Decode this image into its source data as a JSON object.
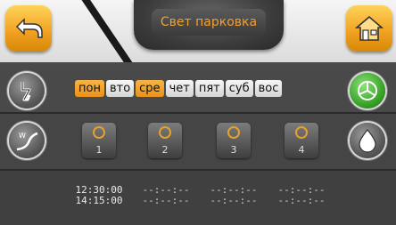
{
  "header": {
    "title": "Свет парковка"
  },
  "days": [
    {
      "label": "пон",
      "active": true
    },
    {
      "label": "вто",
      "active": false
    },
    {
      "label": "сре",
      "active": true
    },
    {
      "label": "чет",
      "active": false
    },
    {
      "label": "пят",
      "active": false
    },
    {
      "label": "суб",
      "active": false
    },
    {
      "label": "вос",
      "active": false
    }
  ],
  "timers": [
    {
      "label": "1",
      "on": "12:30:00",
      "off": "14:15:00"
    },
    {
      "label": "2",
      "on": "--:--:--",
      "off": "--:--:--"
    },
    {
      "label": "3",
      "on": "--:--:--",
      "off": "--:--:--"
    },
    {
      "label": "4",
      "on": "--:--:--",
      "off": "--:--:--"
    }
  ],
  "icons": {
    "back": "back-arrow-icon",
    "home": "home-icon",
    "left1": "electric-bolt-icon",
    "left2": "weather-curve-icon",
    "right1": "pie-chart-icon",
    "right2": "water-drop-icon"
  },
  "colors": {
    "accent": "#f0a020",
    "panel": "#4a4a4a"
  }
}
